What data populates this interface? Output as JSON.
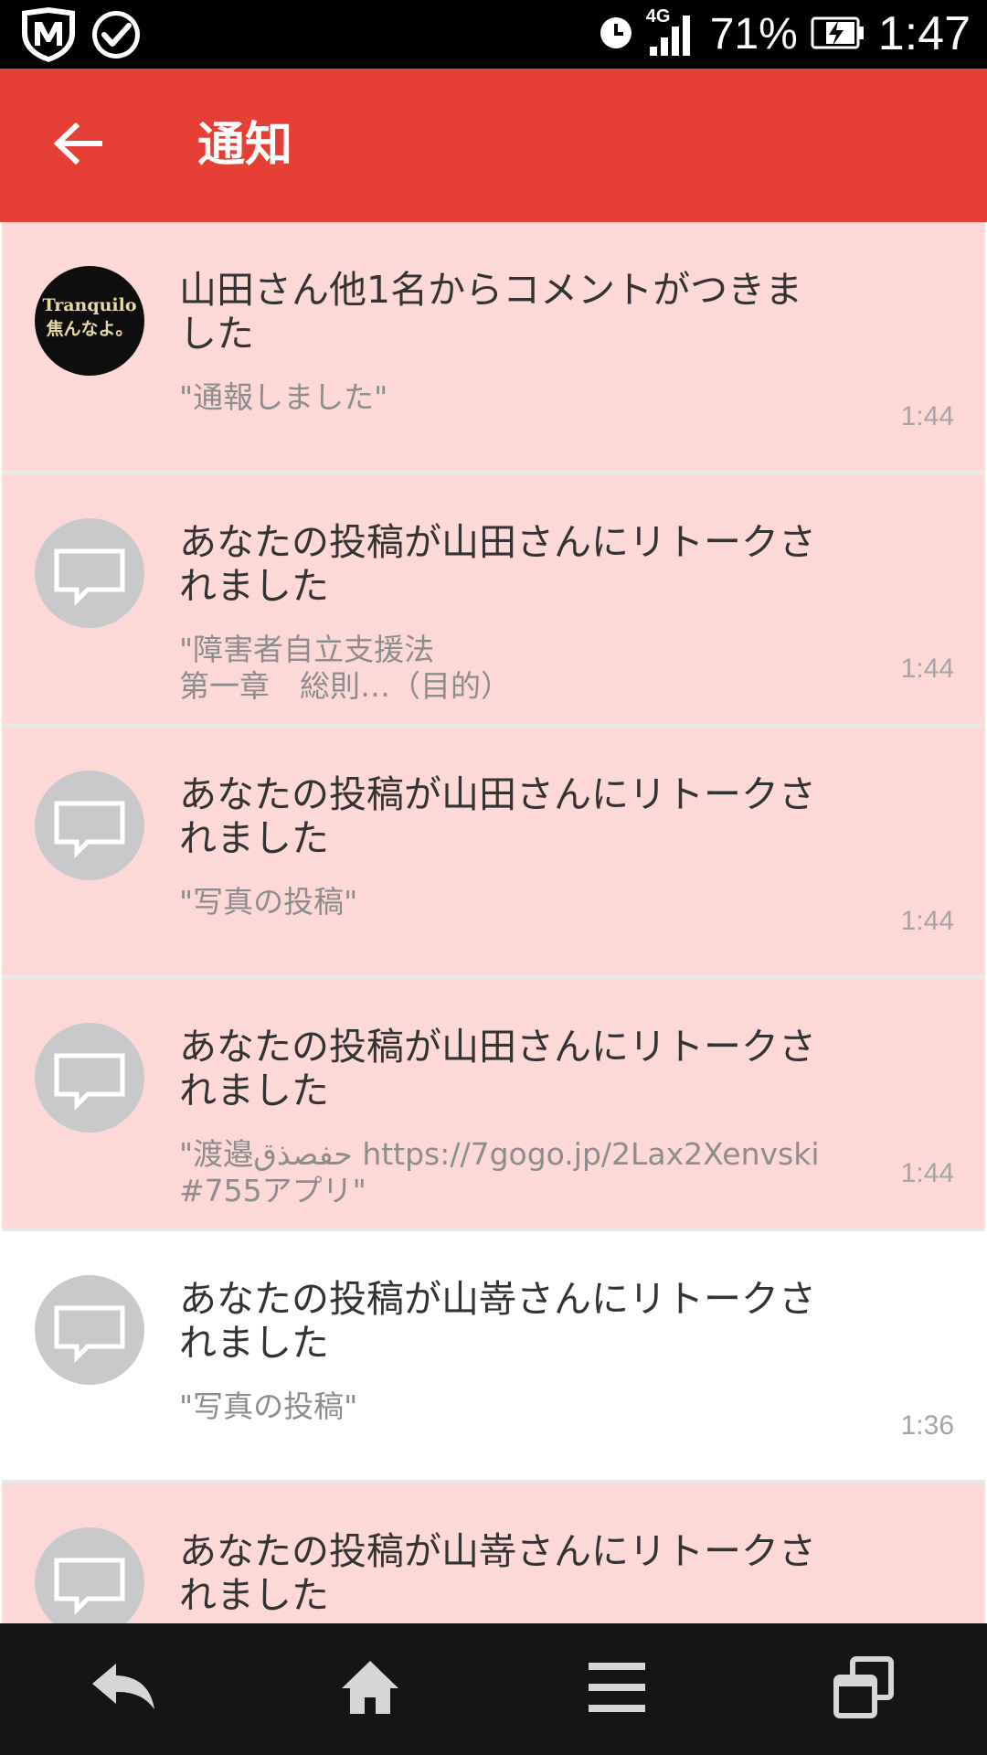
{
  "status_bar": {
    "network": "4G",
    "battery": "71%",
    "time": "1:47"
  },
  "app_bar": {
    "title": "通知"
  },
  "notifications": [
    {
      "title": "山田さん他1名からコメントがつきました",
      "excerpt": "\"通報しました\"",
      "time": "1:44",
      "avatar_text": "Tranquilo\n焦んなよ。",
      "unread": true
    },
    {
      "title": "あなたの投稿が山田さんにリトークされました",
      "excerpt": "\"障害者自立支援法\n第一章　総則…（目的）",
      "time": "1:44",
      "unread": true
    },
    {
      "title": "あなたの投稿が山田さんにリトークされました",
      "excerpt": "\"写真の投稿\"",
      "time": "1:44",
      "unread": true
    },
    {
      "title": "あなたの投稿が山田さんにリトークされました",
      "excerpt": "\"渡邉حفصذق https://7gogo.jp/2Lax2Xenvski\n#755アプリ\"",
      "time": "1:44",
      "unread": true
    },
    {
      "title": "あなたの投稿が山嵜さんにリトークされました",
      "excerpt": "\"写真の投稿\"",
      "time": "1:36",
      "unread": false
    },
    {
      "title": "あなたの投稿が山嵜さんにリトークされました",
      "excerpt": "",
      "time": "",
      "unread": true
    }
  ],
  "icons": {
    "status_left": [
      "mcafee-shield-icon",
      "check-circle-icon"
    ],
    "status_right": [
      "alarm-clock-icon",
      "signal-icon",
      "battery-charging-icon"
    ],
    "nav": [
      "back-arrow-icon",
      "home-icon",
      "menu-icon",
      "recent-apps-icon"
    ]
  },
  "colors": {
    "app_bar": "#e53f36",
    "unread_bg": "#fcd9d7",
    "read_bg": "#ffffff",
    "nav_bg": "#151515",
    "status_bg": "#000000"
  }
}
